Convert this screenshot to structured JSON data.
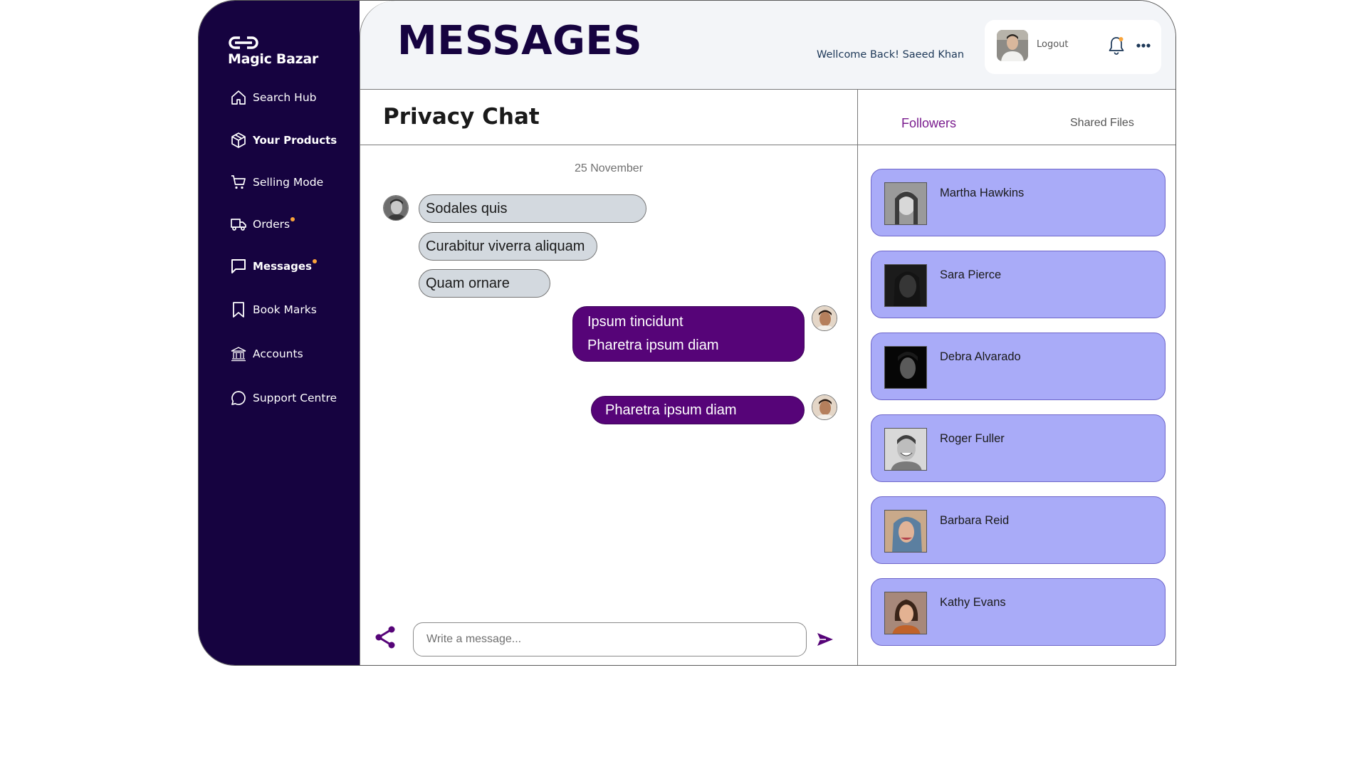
{
  "brand": {
    "name": "Magic Bazar",
    "icon": "link-logo-icon"
  },
  "sidebar": {
    "items": [
      {
        "label": "Search Hub",
        "icon": "home-icon",
        "bold": false,
        "dot": false
      },
      {
        "label": "Your Products",
        "icon": "box-icon",
        "bold": true,
        "dot": false
      },
      {
        "label": "Selling Mode",
        "icon": "cart-icon",
        "bold": false,
        "dot": false
      },
      {
        "label": "Orders",
        "icon": "truck-icon",
        "bold": false,
        "dot": true
      },
      {
        "label": "Messages",
        "icon": "message-icon",
        "bold": true,
        "dot": true
      },
      {
        "label": "Book Marks",
        "icon": "bookmark-icon",
        "bold": false,
        "dot": false
      },
      {
        "label": "Accounts",
        "icon": "bank-icon",
        "bold": false,
        "dot": false
      },
      {
        "label": "Support Centre",
        "icon": "chat-bubble-icon",
        "bold": false,
        "dot": false
      }
    ],
    "dot_color": "#f9a43a"
  },
  "header": {
    "title": "MESSAGES",
    "welcome": "Wellcome Back!  Saeed Khan",
    "logout_label": "Logout",
    "bell_icon": "bell-icon",
    "more_icon": "more-icon"
  },
  "chat": {
    "title": "Privacy Chat",
    "date": "25 November",
    "incoming": [
      "Sodales quis",
      "Curabitur viverra aliquam",
      "Quam ornare"
    ],
    "outgoing_group": [
      "Ipsum tincidunt",
      "Pharetra ipsum diam"
    ],
    "outgoing_single": "Pharetra ipsum diam",
    "composer_placeholder": "Write a message...",
    "share_icon": "share-icon",
    "send_icon": "send-icon"
  },
  "panel": {
    "tabs": [
      "Followers",
      "Shared Files"
    ],
    "active_tab": "Followers",
    "followers": [
      "Martha Hawkins",
      "Sara Pierce",
      "Debra Alvarado",
      "Roger Fuller",
      "Barbara Reid",
      "Kathy Evans"
    ]
  },
  "colors": {
    "sidebar_bg": "#160340",
    "title": "#160340",
    "bubble_out": "#560478",
    "bubble_in": "#d3d9df",
    "follower_card": "#a9abf8",
    "active_tab": "#7a1c8e"
  }
}
